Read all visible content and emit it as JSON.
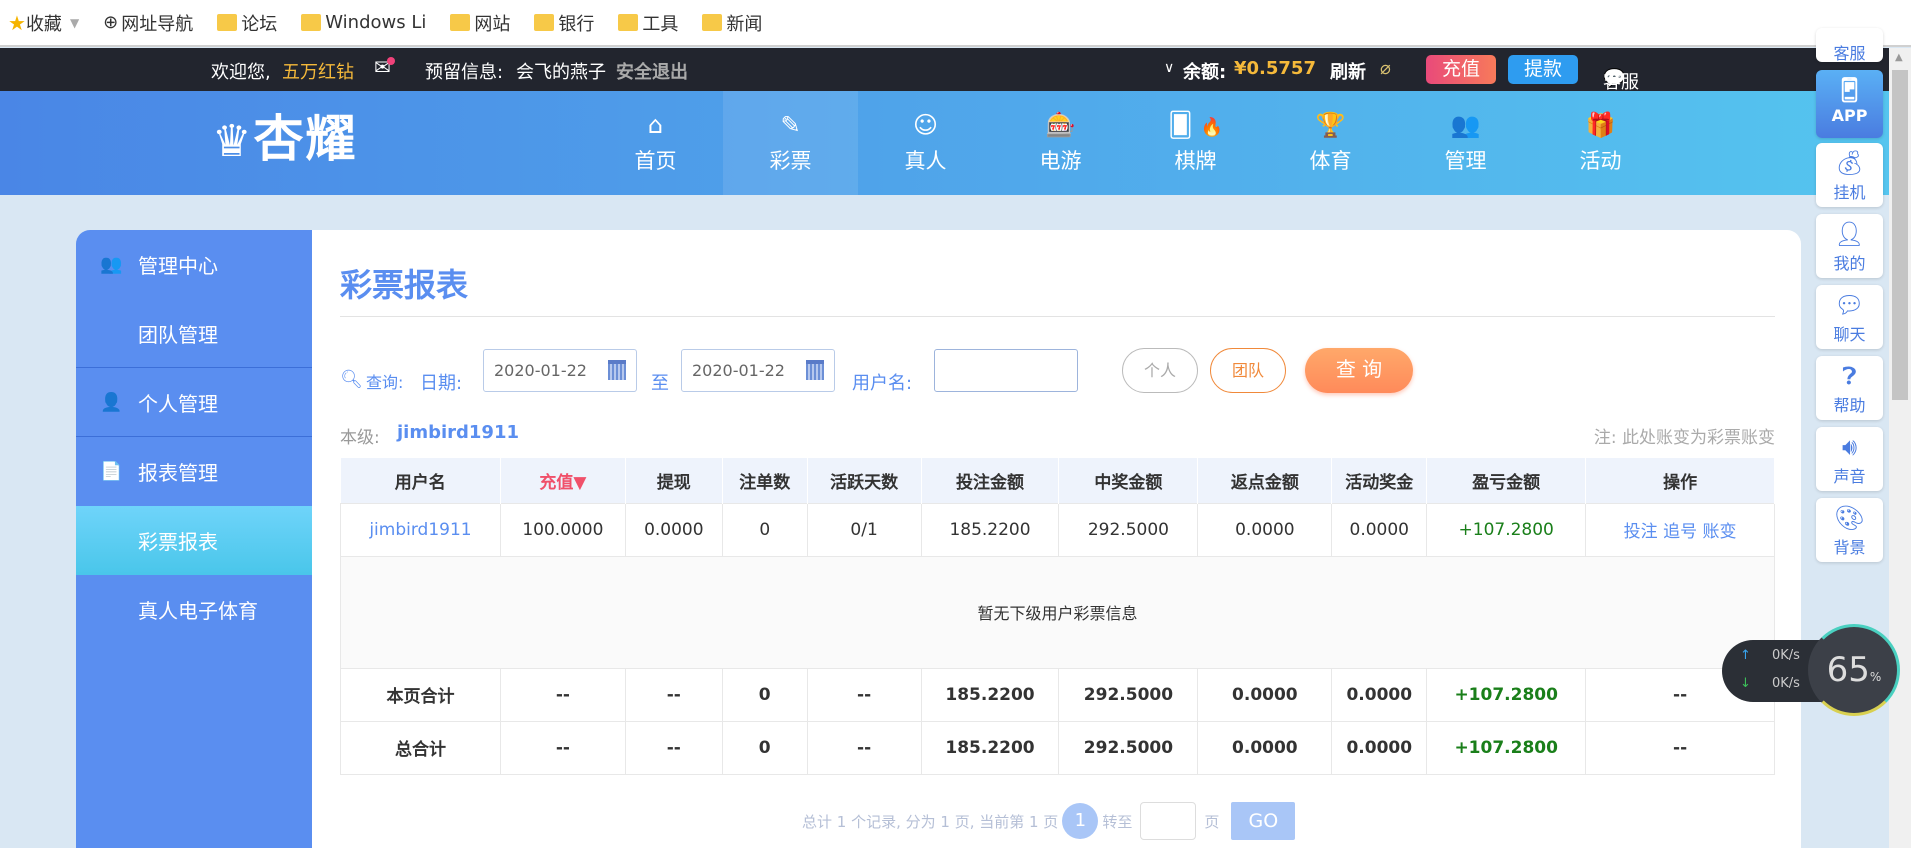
{
  "bookmarks": {
    "favorites": "收藏",
    "nav": "网址导航",
    "folders": [
      "论坛",
      "Windows Li",
      "网站",
      "银行",
      "工具",
      "新闻"
    ]
  },
  "topbar": {
    "welcome": "欢迎您,",
    "username": "五万红钻",
    "reserved_label": "预留信息:",
    "reserved_value": "会飞的燕子",
    "logout": "安全退出",
    "balance_label": "余额:",
    "balance": "¥0.5757",
    "refresh": "刷新",
    "deposit": "充值",
    "withdraw": "提款",
    "service": "客服"
  },
  "header": {
    "logo": "杏耀",
    "nav": [
      {
        "label": "首页",
        "icon": "⌂"
      },
      {
        "label": "彩票",
        "icon": "✎"
      },
      {
        "label": "真人",
        "icon": "☺"
      },
      {
        "label": "电游",
        "icon": "🎰"
      },
      {
        "label": "棋牌",
        "icon": "🂠"
      },
      {
        "label": "体育",
        "icon": "🏆"
      },
      {
        "label": "管理",
        "icon": "👥"
      },
      {
        "label": "活动",
        "icon": "🎁"
      }
    ]
  },
  "sidebar": {
    "items": [
      {
        "label": "管理中心"
      },
      {
        "label": "团队管理"
      },
      {
        "label": "个人管理"
      },
      {
        "label": "报表管理"
      },
      {
        "label": "彩票报表"
      },
      {
        "label": "真人电子体育"
      }
    ]
  },
  "main": {
    "title": "彩票报表",
    "query_label": "查询:",
    "date_label": "日期:",
    "date_from": "2020-01-22",
    "to": "至",
    "date_to": "2020-01-22",
    "username_label": "用户名:",
    "username_value": "",
    "personal": "个人",
    "team": "团队",
    "search": "查 询",
    "level_label": "本级:",
    "level_user": "jimbird1911",
    "note": "注: 此处账变为彩票账变"
  },
  "table": {
    "headers": [
      "用户名",
      "充值▼",
      "提现",
      "注单数",
      "活跃天数",
      "投注金额",
      "中奖金额",
      "返点金额",
      "活动奖金",
      "盈亏金额",
      "操作"
    ],
    "row": {
      "user": "jimbird1911",
      "values": [
        "100.0000",
        "0.0000",
        "0",
        "0/1",
        "185.2200",
        "292.5000",
        "0.0000",
        "0.0000"
      ],
      "profit": "+107.2800",
      "actions": [
        "投注",
        "追号",
        "账变"
      ]
    },
    "empty": "暂无下级用户彩票信息",
    "sums": [
      {
        "label": "本页合计",
        "values": [
          "--",
          "--",
          "0",
          "--",
          "185.2200",
          "292.5000",
          "0.0000",
          "0.0000"
        ],
        "profit": "+107.2800",
        "op": "--"
      },
      {
        "label": "总合计",
        "values": [
          "--",
          "--",
          "0",
          "--",
          "185.2200",
          "292.5000",
          "0.0000",
          "0.0000"
        ],
        "profit": "+107.2800",
        "op": "--"
      }
    ]
  },
  "pagination": {
    "summary": "总计 1 个记录, 分为 1 页, 当前第 1 页",
    "current": "1",
    "goto": "转至",
    "page": "页",
    "go": "GO"
  },
  "right_toolbar": [
    {
      "label": "客服"
    },
    {
      "label": "APP"
    },
    {
      "label": "挂机"
    },
    {
      "label": "我的"
    },
    {
      "label": "聊天"
    },
    {
      "label": "帮助"
    },
    {
      "label": "声音"
    },
    {
      "label": "背景"
    }
  ],
  "speed": {
    "up": "0K/s",
    "down": "0K/s",
    "percent": "65",
    "unit": "%"
  },
  "colors": {
    "primary": "#5a8ef0",
    "deposit": "#f05a7a",
    "withdraw": "#2e9cf0",
    "profit": "#1a7f1a",
    "gold": "#f5b93a"
  }
}
